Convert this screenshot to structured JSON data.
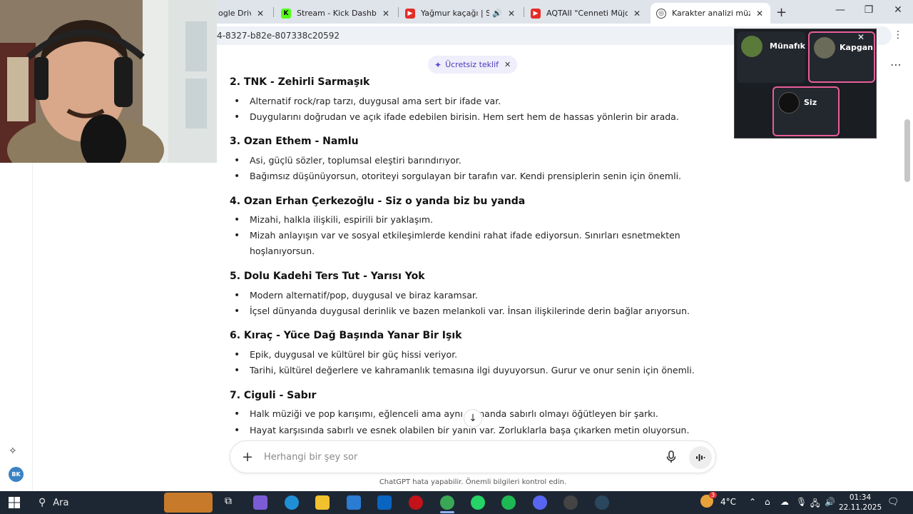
{
  "browser": {
    "tabs": [
      {
        "title": "ogle Drive",
        "favicon": "google-drive-icon",
        "color": "#1a73e8",
        "active": false
      },
      {
        "title": "Stream - Kick Dashboar",
        "favicon": "kick-icon",
        "color": "#2d2d2d",
        "active": false
      },
      {
        "title": "Yağmur kaçağı | Saz",
        "favicon": "youtube-icon",
        "color": "#e52d27",
        "active": false
      },
      {
        "title": "AQTAII \"Cenneti Müjde",
        "favicon": "youtube-icon",
        "color": "#e52d27",
        "active": false
      },
      {
        "title": "Karakter analizi müziğe",
        "favicon": "chatgpt-icon",
        "color": "#444444",
        "active": true
      }
    ],
    "url": "4-8327-b82e-807338c20592"
  },
  "offer": {
    "label": "Ücretsiz teklif"
  },
  "chat": {
    "songs": [
      {
        "title": "2. TNK - Zehirli Sarmaşık",
        "bullets": [
          "Alternatif rock/rap tarzı, duygusal ama sert bir ifade var.",
          "Duygularını doğrudan ve açık ifade edebilen birisin. Hem sert hem de hassas yönlerin bir arada."
        ]
      },
      {
        "title": "3. Ozan Ethem - Namlu",
        "bullets": [
          "Asi, güçlü sözler, toplumsal eleştiri barındırıyor.",
          "Bağımsız düşünüyorsun, otoriteyi sorgulayan bir tarafın var. Kendi prensiplerin senin için önemli."
        ]
      },
      {
        "title": "4. Ozan Erhan Çerkezoğlu - Siz o yanda biz bu yanda",
        "bullets": [
          "Mizahi, halkla ilişkili, espirili bir yaklaşım.",
          "Mizah anlayışın var ve sosyal etkileşimlerde kendini rahat ifade ediyorsun. Sınırları esnetmekten hoşlanıyorsun."
        ]
      },
      {
        "title": "5. Dolu Kadehi Ters Tut - Yarısı Yok",
        "bullets": [
          "Modern alternatif/pop, duygusal ve biraz karamsar.",
          "İçsel dünyanda duygusal derinlik ve bazen melankoli var. İnsan ilişkilerinde derin bağlar arıyorsun."
        ]
      },
      {
        "title": "6. Kıraç - Yüce Dağ Başında Yanar Bir Işık",
        "bullets": [
          "Epik, duygusal ve kültürel bir güç hissi veriyor.",
          "Tarihi, kültürel değerlere ve kahramanlık temasına ilgi duyuyorsun. Gurur ve onur senin için önemli."
        ]
      },
      {
        "title": "7. Ciguli - Sabır",
        "bullets": [
          "Halk müziği ve pop karışımı, eğlenceli ama aynı zamanda sabırlı olmayı öğütleyen bir şarkı.",
          "Hayat karşısında sabırlı ve esnek olabilen bir yanın var. Zorluklarla başa çıkarken metin oluyorsun."
        ]
      }
    ],
    "composer_placeholder": "Herhangi bir şey sor",
    "disclaimer": "ChatGPT hata yapabilir. Önemli bilgileri kontrol edin.",
    "user_initials": "BK"
  },
  "meeting": {
    "participants": [
      {
        "name": "Münafık",
        "speaking": false
      },
      {
        "name": "Kapgan",
        "speaking": true
      },
      {
        "name": "Siz",
        "speaking": true
      }
    ],
    "highlight_color": "#e85d9a"
  },
  "taskbar": {
    "search_label": "Ara",
    "weather": "4°C",
    "time": "01:34",
    "date": "22.11.2025",
    "notification_count": "3",
    "accent": "#8ab4f8"
  }
}
